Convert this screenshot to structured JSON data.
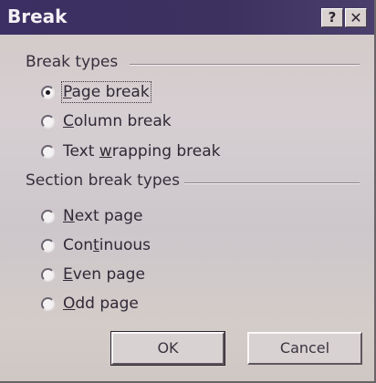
{
  "window": {
    "title": "Break",
    "help_label": "?",
    "close_label": "✕"
  },
  "break_types": {
    "label": "Break types",
    "options": [
      {
        "label_before": "",
        "mnemonic": "P",
        "label_after": "age break",
        "checked": true
      },
      {
        "label_before": "",
        "mnemonic": "C",
        "label_after": "olumn break",
        "checked": false
      },
      {
        "label_before": "Text ",
        "mnemonic": "w",
        "label_after": "rapping break",
        "checked": false
      }
    ]
  },
  "section_break_types": {
    "label": "Section break types",
    "options": [
      {
        "label_before": "",
        "mnemonic": "N",
        "label_after": "ext page",
        "checked": false
      },
      {
        "label_before": "Con",
        "mnemonic": "t",
        "label_after": "inuous",
        "checked": false
      },
      {
        "label_before": "",
        "mnemonic": "E",
        "label_after": "ven page",
        "checked": false
      },
      {
        "label_before": "",
        "mnemonic": "O",
        "label_after": "dd page",
        "checked": false
      }
    ]
  },
  "buttons": {
    "ok": "OK",
    "cancel": "Cancel"
  },
  "colors": {
    "titlebar": "#3b2f63",
    "dialog_face": "#d2c9c6"
  }
}
